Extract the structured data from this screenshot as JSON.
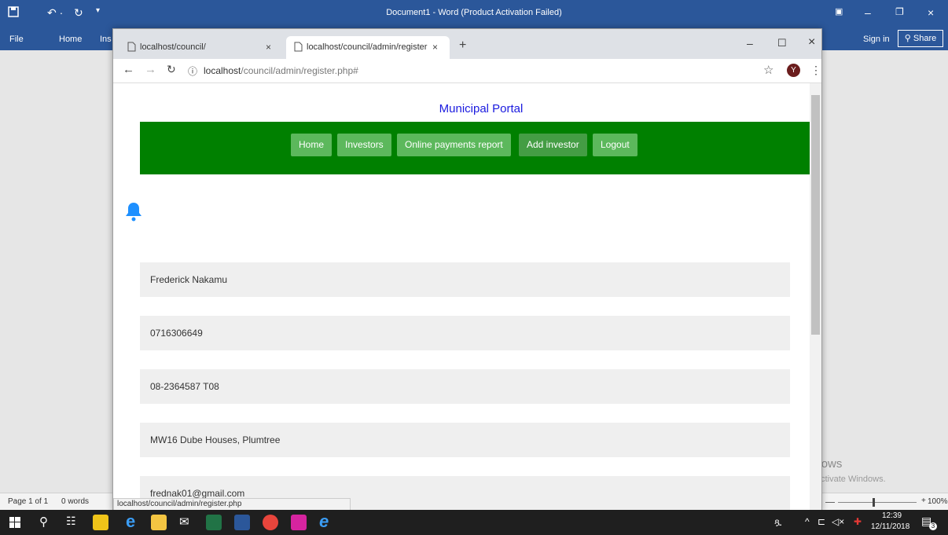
{
  "word": {
    "title": "Document1 - Word (Product Activation Failed)",
    "tabs": [
      "File",
      "Home",
      "Ins"
    ],
    "sign_in": "Sign in",
    "share": "Share",
    "status": {
      "page": "Page 1 of 1",
      "words": "0 words",
      "zoom": "100%"
    },
    "activate_title": "Activate Windows",
    "activate_sub": "Go to Settings to activate Windows."
  },
  "chrome": {
    "tabs": [
      {
        "title": "localhost/council/"
      },
      {
        "title": "localhost/council/admin/register"
      }
    ],
    "address_host": "localhost",
    "address_path": "/council/admin/register.php#",
    "avatar_letter": "Y",
    "status_url": "localhost/council/admin/register.php"
  },
  "page": {
    "title": "Municipal Portal",
    "nav": [
      "Home",
      "Investors",
      "Online payments report",
      "Add investor",
      "Logout"
    ],
    "fields": [
      "Frederick Nakamu",
      "0716306649",
      "08-2364587 T08",
      "MW16 Dube Houses, Plumtree",
      "frednak01@gmail.com"
    ]
  },
  "taskbar": {
    "time": "12:39",
    "date": "12/11/2018",
    "notif_count": "3"
  },
  "colors": {
    "word_blue": "#2b579a",
    "nav_green": "#008000",
    "btn_green": "#5cb85c",
    "portal_blue": "#1a1adf",
    "bell": "#1e90ff"
  }
}
